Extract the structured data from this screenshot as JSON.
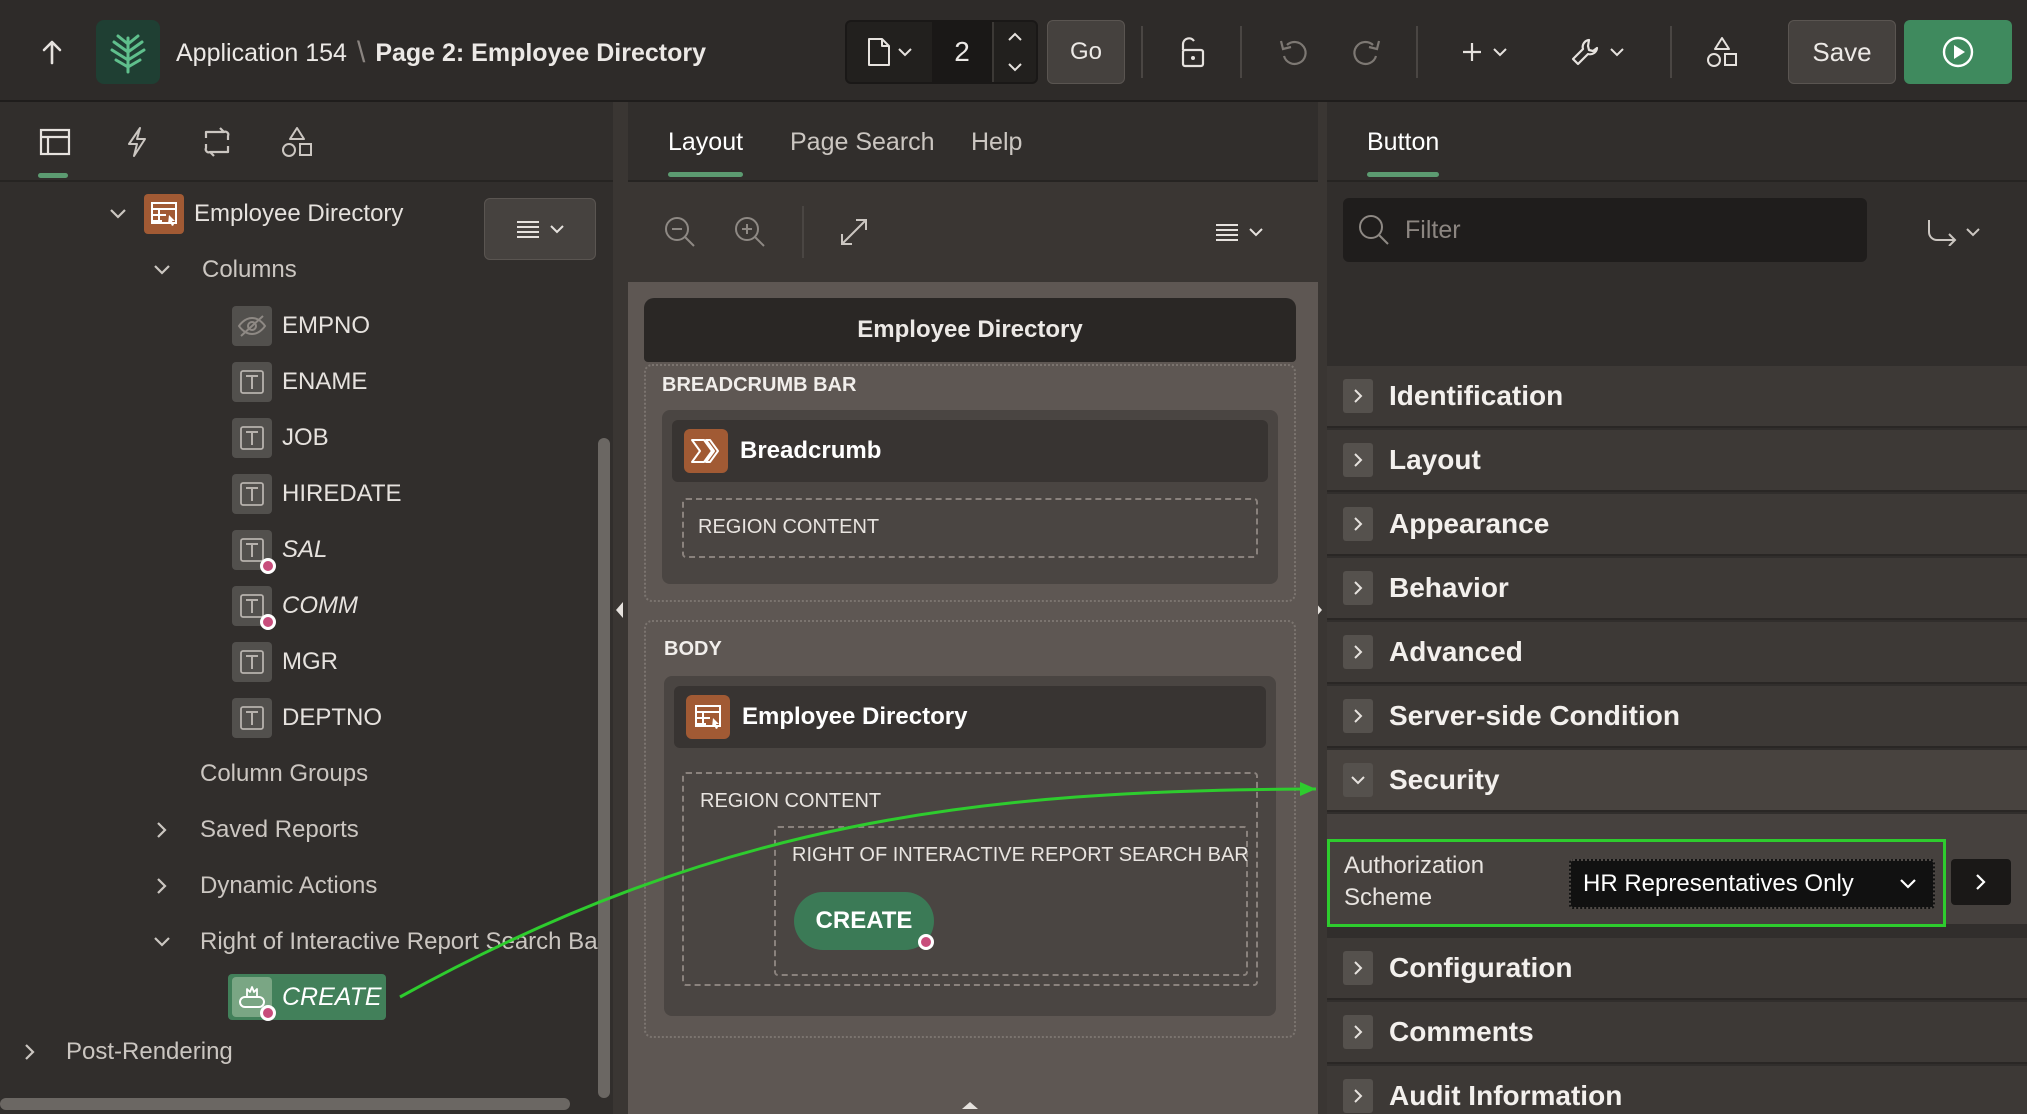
{
  "header": {
    "app_name": "Application 154",
    "separator": "\\",
    "page_title": "Page 2: Employee Directory",
    "page_number": "2",
    "go_label": "Go",
    "save_label": "Save"
  },
  "left_tree": {
    "region": "Employee Directory",
    "columns_label": "Columns",
    "columns": [
      {
        "name": "EMPNO",
        "icon": "hidden-column-icon"
      },
      {
        "name": "ENAME",
        "icon": "text-column-icon"
      },
      {
        "name": "JOB",
        "icon": "text-column-icon"
      },
      {
        "name": "HIREDATE",
        "icon": "text-column-icon"
      },
      {
        "name": "SAL",
        "icon": "text-column-icon"
      },
      {
        "name": "COMM",
        "icon": "text-column-icon"
      },
      {
        "name": "MGR",
        "icon": "text-column-icon"
      },
      {
        "name": "DEPTNO",
        "icon": "text-column-icon"
      }
    ],
    "column_groups": "Column Groups",
    "saved_reports": "Saved Reports",
    "dynamic_actions": "Dynamic Actions",
    "right_of_search": "Right of Interactive Report Search Ba",
    "create_button": "CREATE",
    "post_rendering": "Post-Rendering"
  },
  "center": {
    "tabs": [
      "Layout",
      "Page Search",
      "Help"
    ],
    "active_tab": "Layout",
    "page_title": "Employee Directory",
    "breadcrumb_bar_label": "BREADCRUMB BAR",
    "breadcrumb_region": "Breadcrumb",
    "region_content_label": "REGION CONTENT",
    "body_label": "BODY",
    "employee_region": "Employee Directory",
    "region_content_label_2": "REGION CONTENT",
    "right_of_search_label": "RIGHT OF INTERACTIVE REPORT SEARCH BAR",
    "create_button": "CREATE"
  },
  "right": {
    "tab": "Button",
    "filter_placeholder": "Filter",
    "groups": [
      "Identification",
      "Layout",
      "Appearance",
      "Behavior",
      "Advanced",
      "Server-side Condition",
      "Security",
      "Configuration",
      "Comments",
      "Audit Information"
    ],
    "expanded_group": "Security",
    "auth_label_line1": "Authorization",
    "auth_label_line2": "Scheme",
    "auth_value": "HR Representatives Only"
  },
  "colors": {
    "accent_green": "#5c9b71",
    "run_button": "#3f8a5e",
    "highlight": "#2ecc2e",
    "badge": "#c84d7c",
    "region_icon": "#a15a34"
  }
}
